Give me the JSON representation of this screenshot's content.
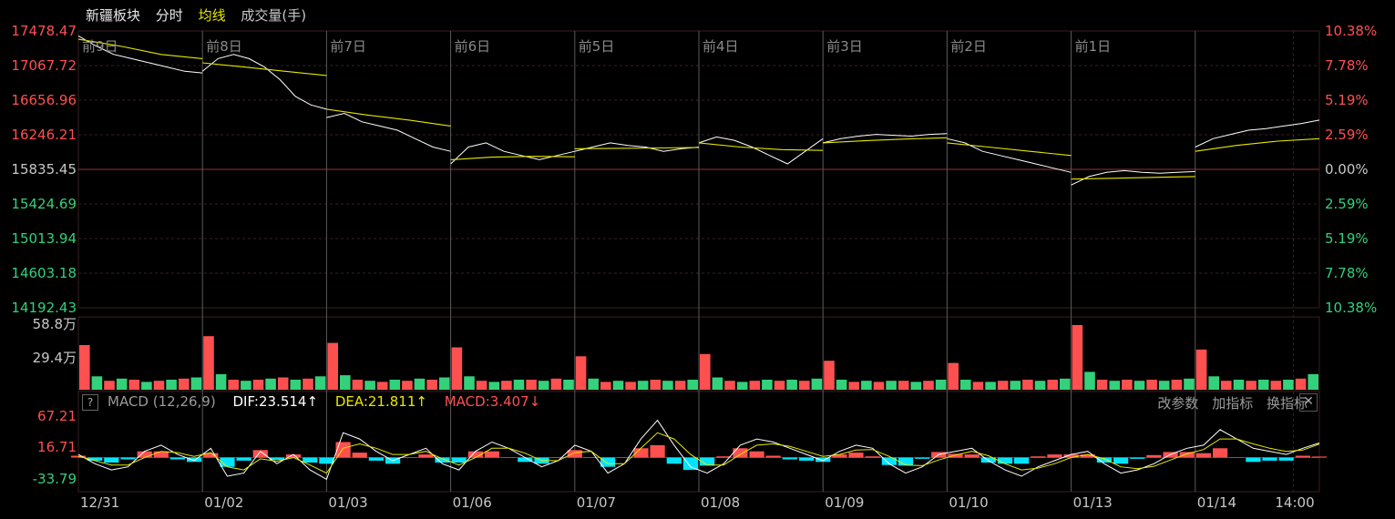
{
  "header": {
    "sector": "新疆板块",
    "mode": "分时",
    "avg_line": "均线",
    "volume_unit": "成交量(手)"
  },
  "colors": {
    "background": "#000000",
    "grid": "#3a2020",
    "price_line": "#ffffff",
    "avg_line": "#e8e800",
    "up": "#ff5050",
    "down": "#33d17a",
    "macd_neg": "#00e5ff",
    "dea": "#e8e800",
    "dif": "#ffffff"
  },
  "price_axis": {
    "labels": [
      "17478.47",
      "17067.72",
      "16656.96",
      "16246.21",
      "15835.45",
      "15424.69",
      "15013.94",
      "14603.18",
      "14192.43"
    ],
    "pct_labels": [
      "10.38%",
      "7.78%",
      "5.19%",
      "2.59%",
      "0.00%",
      "2.59%",
      "5.19%",
      "7.78%",
      "10.38%"
    ]
  },
  "volume_axis": {
    "labels": [
      "58.8万",
      "29.4万"
    ]
  },
  "macd_axis": {
    "labels": [
      "67.21",
      "16.71",
      "-33.79"
    ]
  },
  "macd_header": {
    "help_icon": "?",
    "name": "MACD (12,26,9)",
    "dif": "DIF:23.514↑",
    "dea": "DEA:21.811↑",
    "macd": "MACD:3.407↓"
  },
  "tools": {
    "params": "改参数",
    "add": "加指标",
    "switch": "换指标",
    "close": "✕"
  },
  "chart_data": {
    "type": "line",
    "title": "",
    "xlabel": "",
    "ylabel": "",
    "ylim": [
      14192.43,
      17478.47
    ],
    "prev_close": 15835.45,
    "day_labels": [
      "前9日",
      "前8日",
      "前7日",
      "前6日",
      "前5日",
      "前4日",
      "前3日",
      "前2日",
      "前1日"
    ],
    "x_tick_labels": [
      "12/31",
      "01/02",
      "01/03",
      "01/06",
      "01/07",
      "01/08",
      "01/09",
      "01/10",
      "01/13",
      "01/14",
      "14:00"
    ],
    "days": [
      "12/31",
      "01/02",
      "01/03",
      "01/06",
      "01/07",
      "01/08",
      "01/09",
      "01/10",
      "01/13",
      "01/14"
    ],
    "series": [
      {
        "values": [
          [
            17420,
            17300,
            17200,
            17150,
            17100,
            17050,
            17000,
            16980
          ],
          [
            17000,
            17150,
            17200,
            17150,
            17050,
            16900,
            16700,
            16600,
            16550
          ],
          [
            16450,
            16500,
            16400,
            16350,
            16300,
            16200,
            16100,
            16050
          ],
          [
            15900,
            16100,
            16150,
            16050,
            16000,
            15950,
            16000,
            16050
          ],
          [
            16050,
            16100,
            16150,
            16120,
            16100,
            16050,
            16080,
            16100
          ],
          [
            16150,
            16220,
            16180,
            16100,
            16000,
            15900,
            16050,
            16200
          ],
          [
            16150,
            16200,
            16230,
            16250,
            16240,
            16230,
            16250,
            16260
          ],
          [
            16200,
            16150,
            16050,
            16000,
            15950,
            15900,
            15850,
            15800
          ],
          [
            15650,
            15750,
            15800,
            15820,
            15800,
            15790,
            15800,
            15810
          ],
          [
            16100,
            16200,
            16250,
            16300,
            16320,
            16350,
            16380,
            16420
          ]
        ]
      },
      {
        "values": [
          [
            17380,
            17300,
            17200,
            17150
          ],
          [
            17100,
            17050,
            17000,
            16950
          ],
          [
            16550,
            16480,
            16420,
            16350
          ],
          [
            15950,
            15980,
            15990,
            15985
          ],
          [
            16080,
            16085,
            16090,
            16095
          ],
          [
            16150,
            16100,
            16070,
            16060
          ],
          [
            16150,
            16175,
            16195,
            16210
          ],
          [
            16150,
            16100,
            16050,
            16000
          ],
          [
            15720,
            15730,
            15740,
            15750
          ],
          [
            16050,
            16120,
            16170,
            16200
          ]
        ]
      }
    ],
    "volume": [
      [
        40,
        12,
        8,
        10,
        9,
        7,
        8,
        9,
        10,
        11
      ],
      [
        48,
        14,
        9,
        8,
        9,
        10,
        11,
        9,
        10,
        12
      ],
      [
        42,
        13,
        9,
        8,
        7,
        9,
        8,
        10,
        9,
        11
      ],
      [
        38,
        12,
        8,
        7,
        8,
        9,
        9,
        8,
        10,
        9
      ],
      [
        30,
        10,
        7,
        8,
        7,
        8,
        9,
        8,
        8,
        9
      ],
      [
        32,
        11,
        8,
        7,
        8,
        9,
        8,
        9,
        8,
        10
      ],
      [
        26,
        9,
        7,
        8,
        7,
        8,
        8,
        7,
        8,
        9
      ],
      [
        24,
        9,
        7,
        7,
        8,
        8,
        9,
        8,
        9,
        10
      ],
      [
        58,
        16,
        9,
        8,
        9,
        8,
        9,
        8,
        9,
        10
      ],
      [
        36,
        12,
        8,
        9,
        8,
        9,
        8,
        9,
        10,
        14
      ]
    ],
    "macd": {
      "dif": [
        5,
        -10,
        -20,
        -15,
        10,
        20,
        5,
        -5,
        15,
        -30,
        -25,
        10,
        -10,
        5,
        -20,
        -35,
        40,
        30,
        10,
        -5,
        5,
        15,
        -10,
        -20,
        10,
        25,
        15,
        0,
        -15,
        -5,
        20,
        10,
        -25,
        -10,
        30,
        60,
        20,
        -15,
        -25,
        -10,
        20,
        30,
        25,
        15,
        5,
        -5,
        10,
        20,
        15,
        -10,
        -25,
        -15,
        5,
        10,
        15,
        -5,
        -20,
        -30,
        -15,
        -5,
        5,
        10,
        -10,
        -25,
        -20,
        -10,
        5,
        15,
        20,
        45,
        30,
        15,
        10,
        5,
        15,
        23.5
      ],
      "dea": [
        2,
        -5,
        -12,
        -12,
        0,
        10,
        8,
        2,
        8,
        -15,
        -20,
        -2,
        -6,
        0,
        -12,
        -25,
        15,
        22,
        15,
        5,
        5,
        10,
        -2,
        -12,
        0,
        15,
        15,
        7,
        -5,
        -5,
        8,
        10,
        -10,
        -10,
        15,
        40,
        30,
        5,
        -12,
        -12,
        5,
        20,
        22,
        18,
        10,
        2,
        5,
        12,
        13,
        2,
        -12,
        -13,
        -4,
        4,
        10,
        3,
        -10,
        -20,
        -17,
        -10,
        0,
        5,
        -2,
        -15,
        -18,
        -14,
        -4,
        6,
        13,
        30,
        30,
        22,
        15,
        10,
        12,
        21.8
      ]
    },
    "macd_axis_range": [
      -55,
      80
    ]
  }
}
